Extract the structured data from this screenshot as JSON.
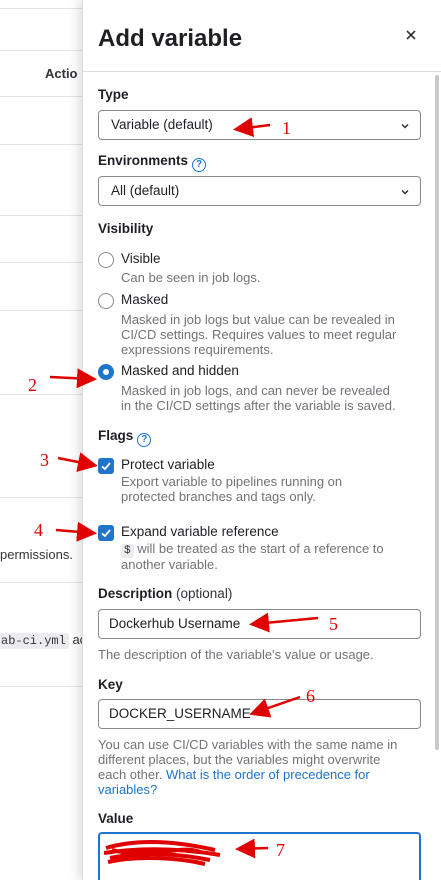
{
  "background": {
    "actions_header": "Actio",
    "permissions_text": "permissions.",
    "code_snippet": "ab-ci.yml",
    "after_code": "ac"
  },
  "drawer": {
    "title": "Add variable",
    "type": {
      "label": "Type",
      "value": "Variable (default)"
    },
    "environments": {
      "label": "Environments",
      "value": "All (default)"
    },
    "visibility": {
      "label": "Visibility",
      "options": [
        {
          "label": "Visible",
          "help": "Can be seen in job logs.",
          "selected": false
        },
        {
          "label": "Masked",
          "help1": "Masked in job logs but value can be revealed in",
          "help2": "CI/CD settings. Requires values to meet regular",
          "help3": "expressions requirements.",
          "selected": false
        },
        {
          "label": "Masked and hidden",
          "help1": "Masked in job logs, and can never be revealed",
          "help2": "in the CI/CD settings after the variable is saved.",
          "selected": true
        }
      ]
    },
    "flags": {
      "label": "Flags",
      "protect": {
        "label": "Protect variable",
        "help1": "Export variable to pipelines running on",
        "help2": "protected branches and tags only.",
        "checked": true
      },
      "expand": {
        "label": "Expand variable reference",
        "code": "$",
        "help1": " will be treated as the start of a reference to",
        "help2": "another variable.",
        "checked": true
      }
    },
    "description": {
      "label": "Description",
      "optional": "(optional)",
      "value": "Dockerhub Username",
      "help": "The description of the variable's value or usage."
    },
    "key": {
      "label": "Key",
      "value": "DOCKER_USERNAME",
      "help1": "You can use CI/CD variables with the same name in",
      "help2": "different places, but the variables might overwrite",
      "help3": "each other. ",
      "link1": "What is the order of precedence for",
      "link2": "variables?"
    },
    "value": {
      "label": "Value"
    }
  },
  "annotations": [
    "1",
    "2",
    "3",
    "4",
    "5",
    "6",
    "7"
  ],
  "colors": {
    "accent": "#1f75cb",
    "annotation": "#e00000"
  }
}
